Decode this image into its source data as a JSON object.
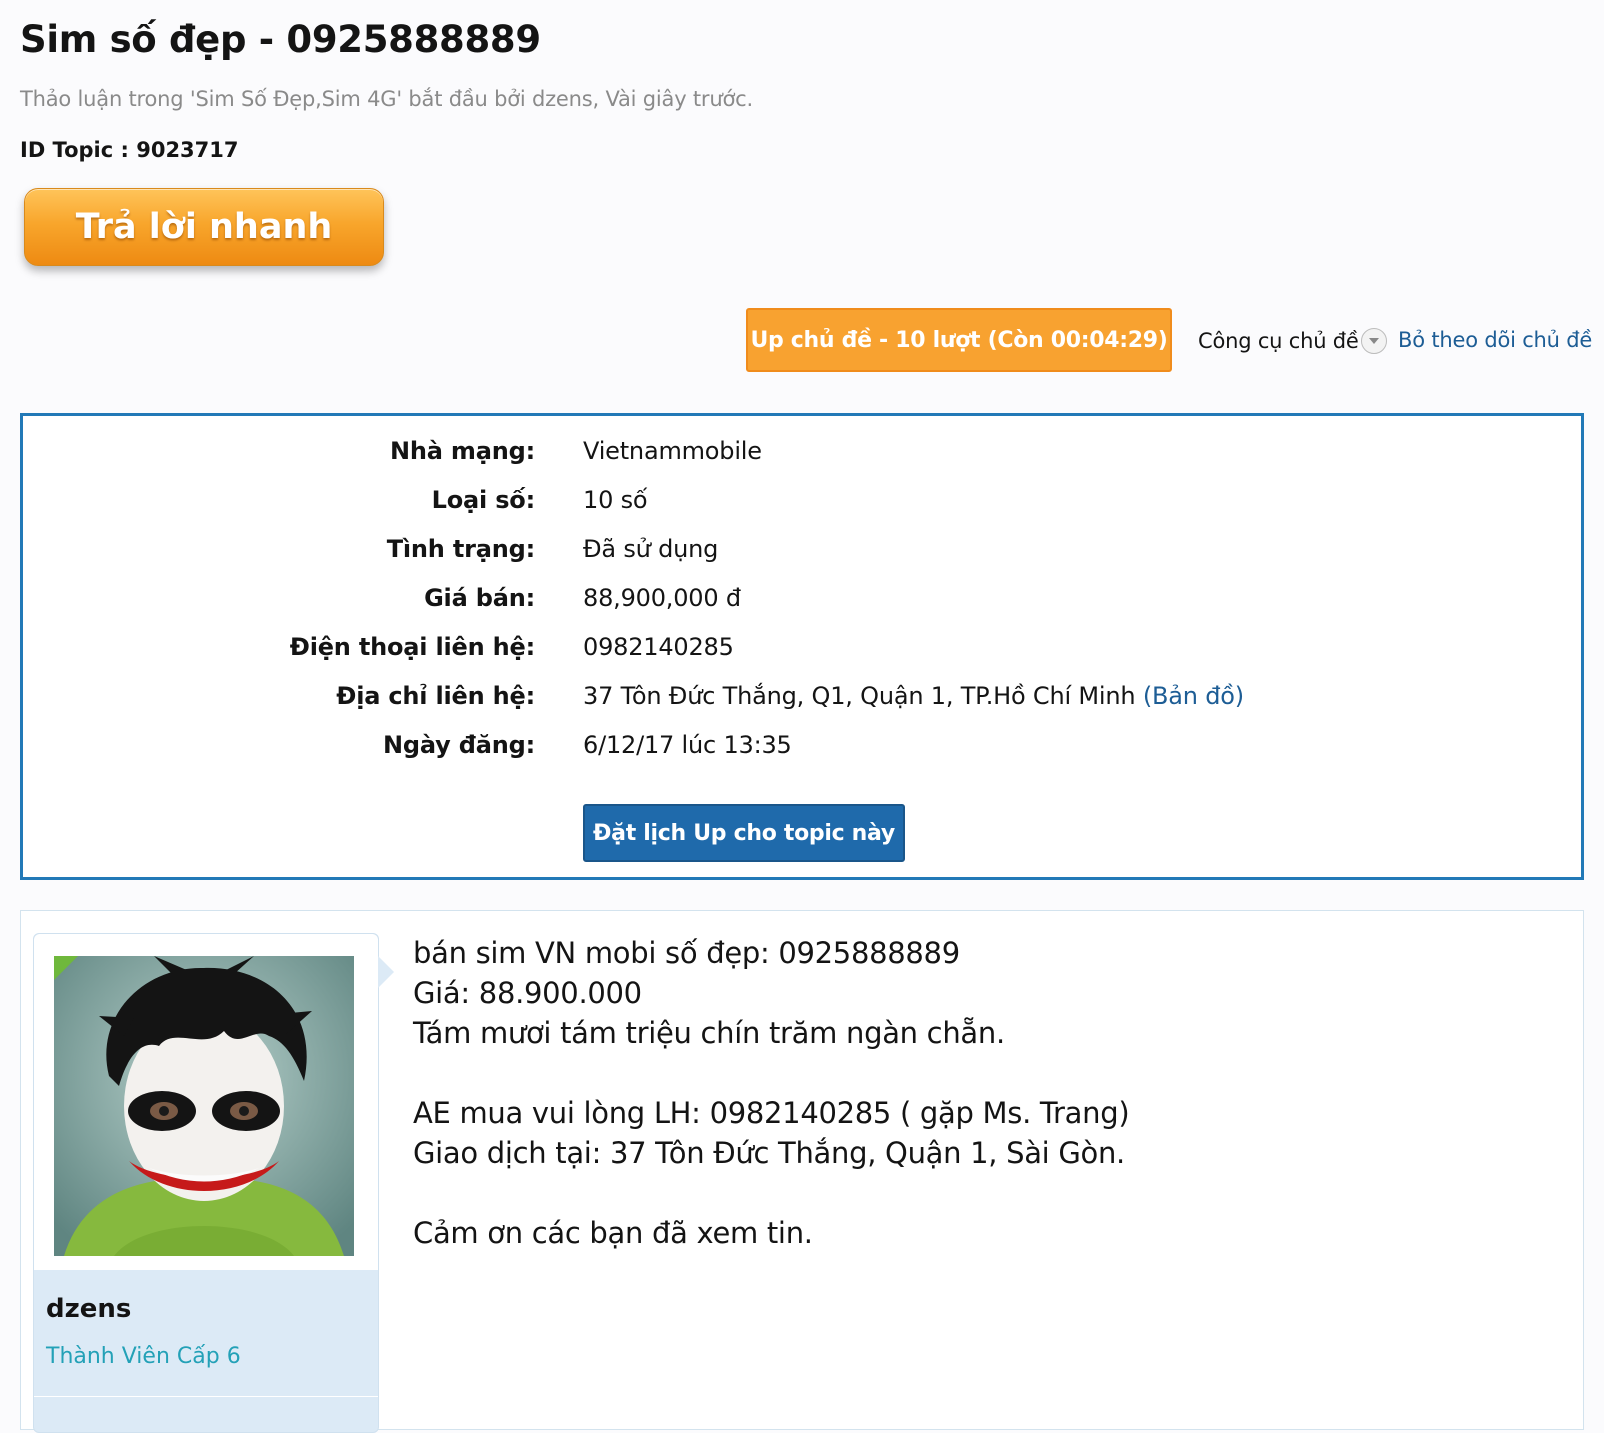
{
  "thread": {
    "title": "Sim số đẹp - 0925888889",
    "meta": "Thảo luận trong 'Sim Số Đẹp,Sim 4G' bắt đầu bởi dzens, Vài giây trước.",
    "id_topic": "ID Topic : 9023717"
  },
  "buttons": {
    "quick_reply": "Trả lời nhanh",
    "up_topic": "Up chủ đề - 10 lượt (Còn 00:04:29)",
    "topic_tools": "Công cụ chủ đề",
    "unfollow": "Bỏ theo dõi chủ đề",
    "schedule_up": "Đặt lịch Up cho topic này"
  },
  "info": {
    "network_label": "Nhà mạng:",
    "network_value": "Vietnammobile",
    "type_label": "Loại số:",
    "type_value": "10 số",
    "status_label": "Tình trạng:",
    "status_value": "Đã sử dụng",
    "price_label": "Giá bán:",
    "price_value": "88,900,000 đ",
    "phone_label": "Điện thoại liên hệ:",
    "phone_value": "0982140285",
    "address_label": "Địa chỉ liên hệ:",
    "address_value": "37 Tôn Đức Thắng, Q1, Quận 1, TP.Hồ Chí Minh",
    "map_link": "(Bản đồ)",
    "date_label": "Ngày đăng:",
    "date_value": "6/12/17 lúc 13:35"
  },
  "post": {
    "username": "dzens",
    "rank": "Thành Viên Cấp 6",
    "lines": [
      "bán sim VN mobi số đẹp: 0925888889",
      "Giá: 88.900.000",
      "Tám mươi tám triệu chín trăm ngàn chẵn.",
      "",
      "AE mua vui lòng LH: 0982140285 ( gặp Ms. Trang)",
      "Giao dịch tại: 37 Tôn Đức Thắng, Quận 1, Sài Gòn.",
      "",
      "Cảm ơn các bạn đã xem tin."
    ]
  },
  "colors": {
    "accent_blue": "#2279b7",
    "link_blue": "#1d5d95",
    "orange": "#f8a230",
    "rank_teal": "#23a1b7",
    "online_green": "#6fb83c"
  },
  "icons": {
    "topic_tools": "chevron-down-circle-icon",
    "online": "online-indicator-icon"
  }
}
